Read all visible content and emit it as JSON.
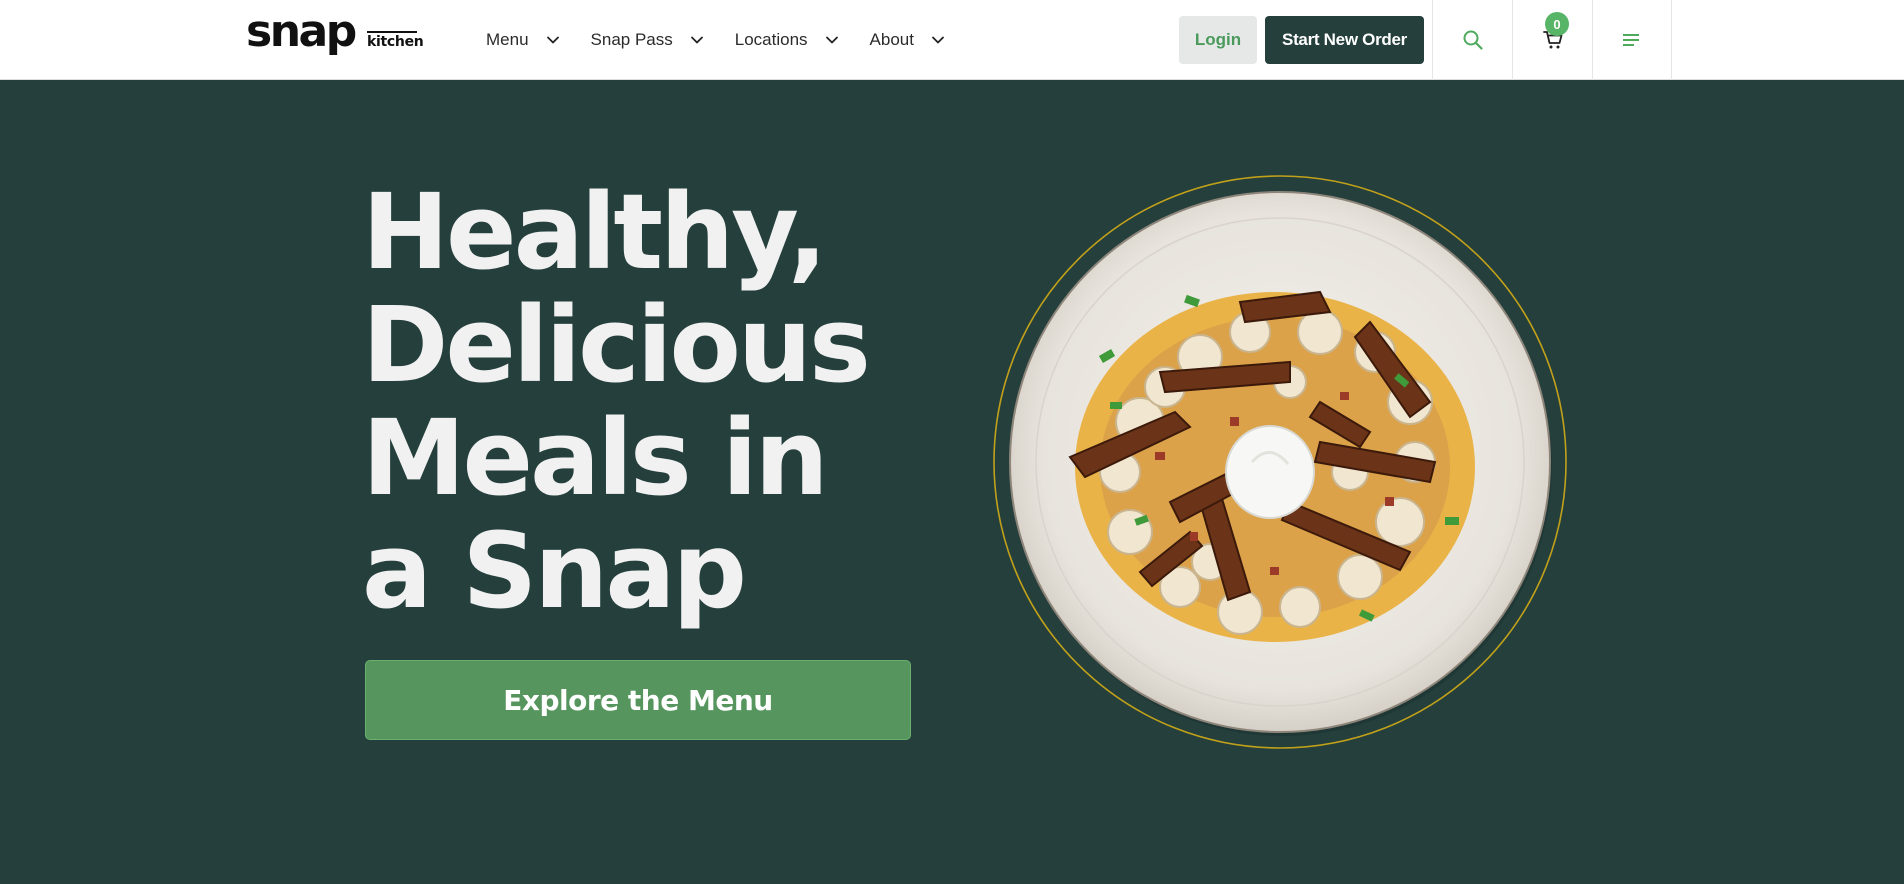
{
  "header": {
    "logo": {
      "word": "snap",
      "sub": "kitchen"
    },
    "nav": [
      {
        "label": "Menu"
      },
      {
        "label": "Snap Pass"
      },
      {
        "label": "Locations"
      },
      {
        "label": "About"
      }
    ],
    "login_label": "Login",
    "start_order_label": "Start New Order",
    "cart_count": "0"
  },
  "hero": {
    "title_lines": [
      "Healthy,",
      "Delicious",
      "Meals in",
      "a Snap"
    ],
    "cta_label": "Explore the Menu"
  },
  "colors": {
    "brand_dark": "#243f3c",
    "brand_green": "#57955e",
    "accent_green": "#58b466",
    "ring_gold": "#c2a11a"
  },
  "icons": [
    "chevron-down-icon",
    "search-icon",
    "cart-icon",
    "hamburger-menu-icon"
  ]
}
